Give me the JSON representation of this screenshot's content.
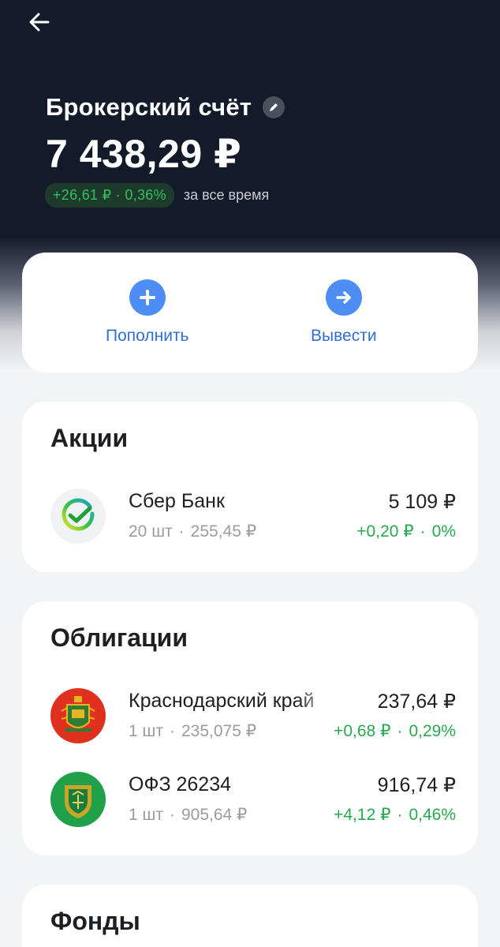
{
  "header": {
    "back_icon": "arrow-left-icon",
    "title": "Брокерский счёт",
    "edit_icon": "pencil-icon",
    "balance": "7 438,29 ₽",
    "gain_amount": "+26,61 ₽",
    "gain_percent": "0,36%",
    "gain_period": "за все время"
  },
  "actions": {
    "deposit": {
      "label": "Пополнить",
      "icon": "plus-icon"
    },
    "withdraw": {
      "label": "Вывести",
      "icon": "arrow-right-icon"
    }
  },
  "stocks": {
    "title": "Акции",
    "items": [
      {
        "name": "Сбер Банк",
        "qty": "20 шт",
        "price": "255,45 ₽",
        "value": "5 109 ₽",
        "change_abs": "+0,20 ₽",
        "change_pct": "0%",
        "logo": "sber-logo-icon"
      }
    ]
  },
  "bonds": {
    "title": "Облигации",
    "items": [
      {
        "name": "Краснодарский край",
        "qty": "1 шт",
        "price": "235,075 ₽",
        "value": "237,64 ₽",
        "change_abs": "+0,68 ₽",
        "change_pct": "0,29%",
        "logo": "krasnodar-coat-of-arms-icon"
      },
      {
        "name": "ОФЗ 26234",
        "qty": "1 шт",
        "price": "905,64 ₽",
        "value": "916,74 ₽",
        "change_abs": "+4,12 ₽",
        "change_pct": "0,46%",
        "logo": "minfin-emblem-icon"
      }
    ]
  },
  "funds": {
    "title": "Фонды"
  },
  "colors": {
    "header_bg": "#131a2a",
    "accent_blue": "#4e8df6",
    "positive_green": "#27a94e"
  }
}
